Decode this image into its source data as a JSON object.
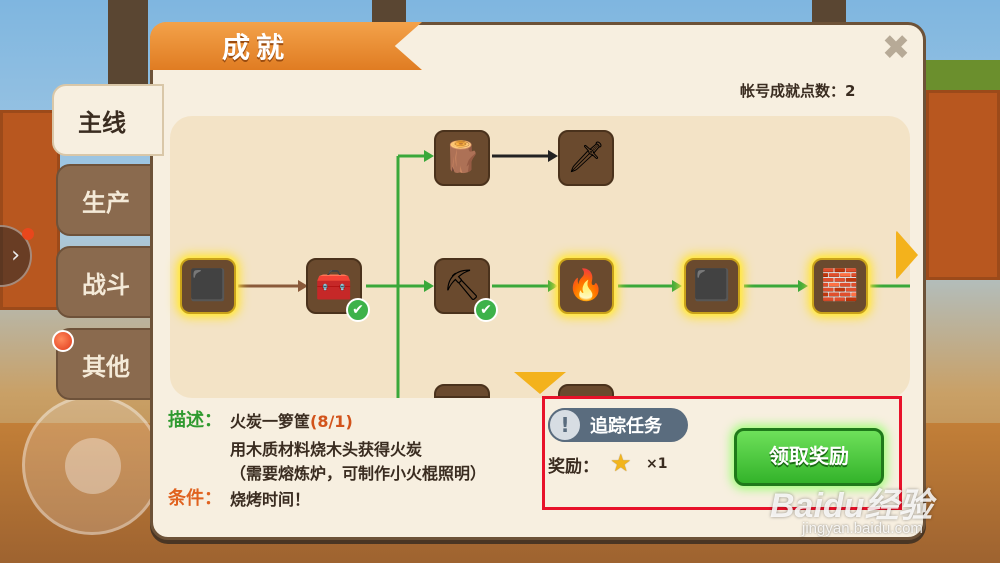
{
  "window": {
    "title": "成就",
    "close_icon": "close-icon"
  },
  "account": {
    "points_label": "帐号成就点数：2"
  },
  "tabs": [
    {
      "label": "主线",
      "active": true
    },
    {
      "label": "生产",
      "active": false
    },
    {
      "label": "战斗",
      "active": false
    },
    {
      "label": "其他",
      "active": false,
      "has_notification": true
    }
  ],
  "achievement_tree": {
    "nodes": [
      {
        "id": "wood-block",
        "icon": "dark-block-icon",
        "glow": true,
        "completed": false
      },
      {
        "id": "crafting-table",
        "icon": "crafting-table-icon",
        "glow": false,
        "completed": true
      },
      {
        "id": "wooden-club",
        "icon": "wooden-club-icon",
        "glow": false,
        "completed": false
      },
      {
        "id": "stone-sword",
        "icon": "sword-icon",
        "glow": false,
        "completed": false
      },
      {
        "id": "pickaxe",
        "icon": "pickaxe-icon",
        "glow": false,
        "completed": true
      },
      {
        "id": "furnace",
        "icon": "furnace-icon",
        "glow": true,
        "completed": false
      },
      {
        "id": "coal",
        "icon": "coal-icon",
        "glow": true,
        "completed": false
      },
      {
        "id": "iron-ingot",
        "icon": "iron-ingot-icon",
        "glow": true,
        "completed": false
      },
      {
        "id": "bottom-left-item",
        "icon": "bow-icon",
        "glow": false,
        "completed": false
      },
      {
        "id": "bottom-right-item",
        "icon": "dark-item-icon",
        "glow": false,
        "completed": false
      }
    ]
  },
  "description": {
    "label": "描述：",
    "title": "火炭一箩筐",
    "progress": "(8/1)",
    "lines": [
      "用木质材料烧木头获得火炭",
      "（需要熔炼炉，可制作小火棍照明）"
    ]
  },
  "condition": {
    "label": "条件：",
    "text": "烧烤时间！"
  },
  "reward": {
    "track_label": "追踪任务",
    "reward_label": "奖励：",
    "star_count": "×1",
    "claim_label": "领取奖励"
  },
  "watermark": {
    "logo": "Baidu经验",
    "url": "jingyan.baidu.com"
  },
  "colors": {
    "accent_green": "#33b32a",
    "title_orange": "#e07c22",
    "highlight_red": "#e8122a"
  }
}
